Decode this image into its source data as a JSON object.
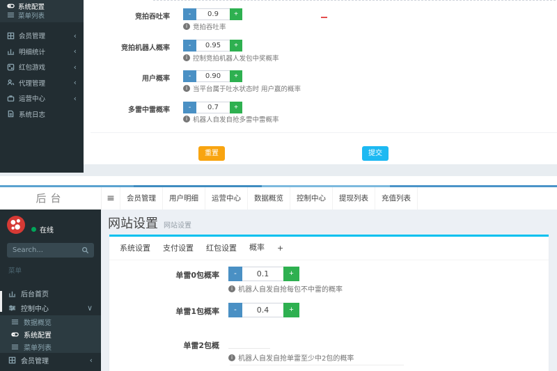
{
  "ui": {
    "minus": "-",
    "plus": "+",
    "info": "i",
    "hamburger": "≡",
    "chevron_left": "‹",
    "chevron_down": "∨"
  },
  "colors": {
    "sidebar_bg": "#222d32",
    "submenu_bg": "#2c3b41",
    "minus_button": "#4a90c4",
    "plus_button": "#2eb050",
    "reset_button": "#f8a410",
    "submit_button": "#1db9f2",
    "panel_top_border": "#00c0ef",
    "active_tab_border": "#3c8dbc",
    "online_dot": "#00a65a",
    "logo_red": "#d63a35"
  },
  "top": {
    "sidebar": {
      "submenu": [
        {
          "label": "系统配置"
        },
        {
          "label": "菜单列表"
        }
      ],
      "items": [
        {
          "label": "会员管理"
        },
        {
          "label": "明细统计"
        },
        {
          "label": "红包游戏"
        },
        {
          "label": "代理管理"
        },
        {
          "label": "运营中心"
        },
        {
          "label": "系统日志"
        }
      ]
    },
    "form": {
      "fields": [
        {
          "label": "竞拍吞吐率",
          "value": "0.9",
          "hint": "竞拍吞吐率"
        },
        {
          "label": "竞拍机器人概率",
          "value": "0.95",
          "hint": "控制竞拍机器人发包中奖概率"
        },
        {
          "label": "用户概率",
          "value": "0.90",
          "hint": "当平台属于吐水状态时 用户赢的概率"
        },
        {
          "label": "多雷中雷概率",
          "value": "0.7",
          "hint": "机器人自发自抢多雷中雷概率"
        }
      ],
      "reset_label": "重置",
      "submit_label": "提交"
    }
  },
  "bottom": {
    "header": {
      "logo": "后台",
      "nav": [
        {
          "label": "会员管理"
        },
        {
          "label": "用户明细"
        },
        {
          "label": "运营中心"
        },
        {
          "label": "数据概览"
        },
        {
          "label": "控制中心"
        },
        {
          "label": "提现列表"
        },
        {
          "label": "充值列表"
        }
      ]
    },
    "sidebar": {
      "status": "在线",
      "search_placeholder": "Search...",
      "section_label": "菜单",
      "home": "后台首页",
      "control": "控制中心",
      "submenu": [
        {
          "label": "数据概览"
        },
        {
          "label": "系统配置"
        },
        {
          "label": "菜单列表"
        }
      ],
      "member": "会员管理"
    },
    "main": {
      "title": "网站设置",
      "subtitle": "网站设置",
      "tabs": [
        {
          "label": "系统设置"
        },
        {
          "label": "支付设置"
        },
        {
          "label": "红包设置"
        },
        {
          "label": "概率"
        },
        {
          "label": "+"
        }
      ],
      "fields": [
        {
          "label": "单雷0包概率",
          "value": "0.1",
          "hint": "机器人自发自抢每包不中雷的概率"
        },
        {
          "label": "单雷1包概率",
          "value": "0.4",
          "hint": ""
        },
        {
          "label": "单雷2包概",
          "value": "",
          "hint": "机器人自发自抢单雷至少中2包的概率"
        }
      ]
    }
  }
}
